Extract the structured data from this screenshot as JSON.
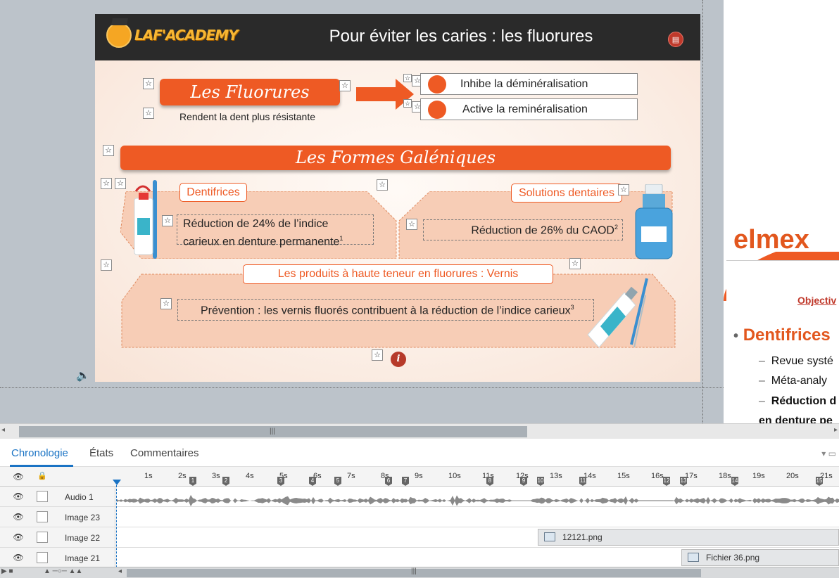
{
  "slide": {
    "logo_text": "LAF'ACADEMY",
    "title": "Pour éviter les caries : les fluorures",
    "fluorures_label": "Les Fluorures",
    "fluorures_caption": "Rendent la dent plus résistante",
    "bullet1": "Inhibe la déminéralisation",
    "bullet2": "Active la reminéralisation",
    "formes_label": "Les Formes Galéniques",
    "dentifrices_label": "Dentifrices",
    "dentifrices_text_1": "Réduction de 24% de l’indice",
    "dentifrices_text_2": "carieux en denture permanente",
    "dentifrices_sup": "1",
    "solutions_label": "Solutions dentaires",
    "solutions_text": "Réduction de 26% du CAOD",
    "solutions_sup": "2",
    "vernis_label": "Les produits à haute teneur en fluorures : Vernis",
    "vernis_text": "Prévention : les vernis fluorés contribuent à la réduction de l’indice carieux",
    "vernis_sup": "3",
    "info_glyph": "i"
  },
  "right_panel": {
    "brand": "elmex",
    "objective": "Objectiv",
    "heading": "Dentifrices",
    "line1": "Revue systé",
    "line2": "Méta-analy",
    "line3": "Réduction d",
    "line4": "en denture pe"
  },
  "timeline": {
    "tabs": [
      "Chronologie",
      "États",
      "Commentaires"
    ],
    "rows": [
      {
        "label": "Audio 1"
      },
      {
        "label": "Image 23"
      },
      {
        "label": "Image 22"
      },
      {
        "label": "Image 21"
      }
    ],
    "ticks": [
      "1s",
      "2s",
      "3s",
      "4s",
      "5s",
      "6s",
      "7s",
      "8s",
      "9s",
      "10s",
      "11s",
      "12s",
      "13s",
      "14s",
      "15s",
      "16s",
      "17s",
      "18s",
      "19s",
      "20s",
      "21s"
    ],
    "markers": [
      "1",
      "2",
      "3",
      "4",
      "5",
      "6",
      "7",
      "8",
      "9",
      "10",
      "11",
      "12",
      "13",
      "14",
      "15"
    ],
    "image22_file": "12121.png",
    "image21_file": "Fichier 36.png"
  },
  "colors": {
    "accent": "#ee5a24",
    "header": "#2a2a2a",
    "tab_active": "#1a73c4"
  }
}
